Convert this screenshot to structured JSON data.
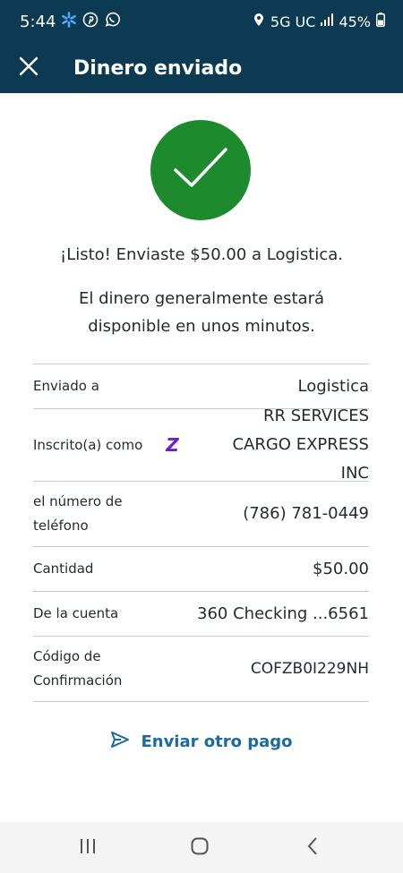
{
  "status_bar": {
    "time": "5:44",
    "network": "5G UC",
    "battery": "45%",
    "icons": [
      "walmart-spark-icon",
      "pinterest-icon",
      "whatsapp-icon",
      "location-icon",
      "signal-icon",
      "battery-icon"
    ]
  },
  "header": {
    "title": "Dinero enviado",
    "close_icon": "close-icon",
    "background": "#0b3a52"
  },
  "success": {
    "icon": "checkmark-icon",
    "color": "#1e8a2e",
    "message": "¡Listo! Enviaste $50.00 a Logistica.",
    "info": "El dinero generalmente estará disponible en unos minutos."
  },
  "details": [
    {
      "label": "Enviado a",
      "value": "Logistica"
    },
    {
      "label": "Inscrito(a) como",
      "value": "RR SERVICES CARGO EXPRESS INC",
      "icon": "zelle-icon"
    },
    {
      "label": "el número de teléfono",
      "value": "(786) 781-0449"
    },
    {
      "label": "Cantidad",
      "value": "$50.00"
    },
    {
      "label": "De la cuenta",
      "value": "360 Checking ...6561"
    },
    {
      "label": "Código de Confirmación",
      "value": "COFZB0I229NH"
    }
  ],
  "actions": {
    "send_again": "Enviar otro pago",
    "send_icon": "send-icon",
    "accent": "#1b6aa3"
  },
  "nav": [
    "recent-apps-icon",
    "home-icon",
    "back-icon"
  ]
}
